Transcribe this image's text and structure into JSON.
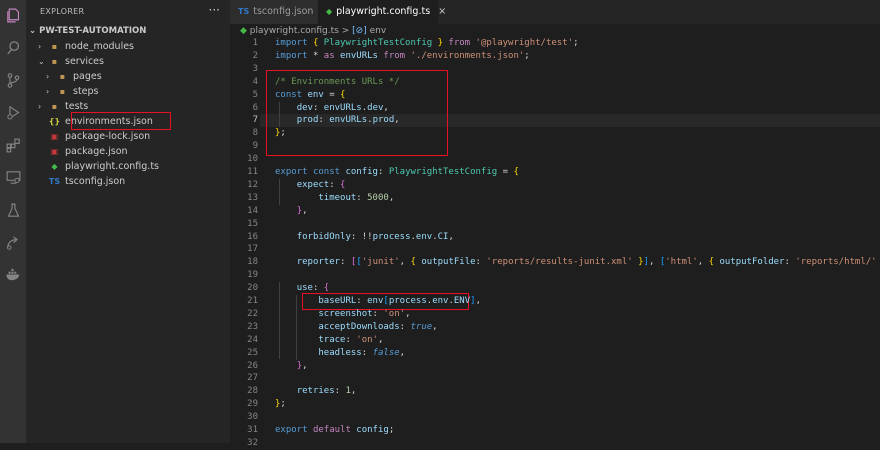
{
  "explorer": {
    "title": "EXPLORER",
    "more": "···",
    "project": "PW-TEST-AUTOMATION",
    "items": [
      {
        "label": "node_modules",
        "icon": "folder-icon",
        "depth": 0,
        "chevron": "›"
      },
      {
        "label": "services",
        "icon": "folder-icon",
        "depth": 0,
        "chevron": "⌄"
      },
      {
        "label": "pages",
        "icon": "folder-icon",
        "depth": 1,
        "chevron": "›"
      },
      {
        "label": "steps",
        "icon": "folder-icon",
        "depth": 1,
        "chevron": "›"
      },
      {
        "label": "tests",
        "icon": "folder-icon",
        "depth": 0,
        "chevron": "›"
      },
      {
        "label": "environments.json",
        "icon": "json-icon",
        "depth": 0,
        "chevron": ""
      },
      {
        "label": "package-lock.json",
        "icon": "npm-icon",
        "depth": 0,
        "chevron": ""
      },
      {
        "label": "package.json",
        "icon": "npm-icon",
        "depth": 0,
        "chevron": ""
      },
      {
        "label": "playwright.config.ts",
        "icon": "playwright-icon",
        "depth": 0,
        "chevron": ""
      },
      {
        "label": "tsconfig.json",
        "icon": "typescript-icon",
        "depth": 0,
        "chevron": ""
      }
    ]
  },
  "tabs": [
    {
      "label": "tsconfig.json",
      "icon": "TS",
      "active": false
    },
    {
      "label": "playwright.config.ts",
      "icon": "◆",
      "active": true,
      "close": "×"
    }
  ],
  "breadcrumb": {
    "file": "playwright.config.ts",
    "sep": ">",
    "symbol_icon": "[⊘]",
    "symbol": "env"
  },
  "editor": {
    "current_line": 7,
    "lines": [
      [
        [
          "k",
          "import "
        ],
        [
          "b",
          "{ "
        ],
        [
          "t",
          "PlaywrightTestConfig "
        ],
        [
          "b",
          "} "
        ],
        [
          "kc",
          "from "
        ],
        [
          "s",
          "'@playwright/test'"
        ],
        [
          "p",
          ";"
        ]
      ],
      [
        [
          "k",
          "import "
        ],
        [
          "p",
          "* "
        ],
        [
          "kc",
          "as "
        ],
        [
          "v",
          "envURLs "
        ],
        [
          "kc",
          "from "
        ],
        [
          "s",
          "'./environments.json'"
        ],
        [
          "p",
          ";"
        ]
      ],
      [],
      [
        [
          "c",
          "/* Environments URLs */"
        ]
      ],
      [
        [
          "k",
          "const "
        ],
        [
          "v",
          "env "
        ],
        [
          "p",
          "= "
        ],
        [
          "b",
          "{"
        ]
      ],
      [
        [
          "p",
          "    "
        ],
        [
          "v",
          "dev"
        ],
        [
          "p",
          ": "
        ],
        [
          "v",
          "envURLs"
        ],
        [
          "p",
          "."
        ],
        [
          "v",
          "dev"
        ],
        [
          "p",
          ","
        ]
      ],
      [
        [
          "p",
          "    "
        ],
        [
          "v",
          "prod"
        ],
        [
          "p",
          ": "
        ],
        [
          "v",
          "envURLs"
        ],
        [
          "p",
          "."
        ],
        [
          "v",
          "prod"
        ],
        [
          "p",
          ","
        ]
      ],
      [
        [
          "b",
          "}"
        ],
        [
          "p",
          ";"
        ]
      ],
      [],
      [],
      [
        [
          "k",
          "export "
        ],
        [
          "k",
          "const "
        ],
        [
          "v",
          "config"
        ],
        [
          "p",
          ": "
        ],
        [
          "t",
          "PlaywrightTestConfig "
        ],
        [
          "p",
          "= "
        ],
        [
          "b",
          "{"
        ]
      ],
      [
        [
          "p",
          "    "
        ],
        [
          "v",
          "expect"
        ],
        [
          "p",
          ": "
        ],
        [
          "b2",
          "{"
        ]
      ],
      [
        [
          "p",
          "        "
        ],
        [
          "v",
          "timeout"
        ],
        [
          "p",
          ": "
        ],
        [
          "n",
          "5000"
        ],
        [
          "p",
          ","
        ]
      ],
      [
        [
          "p",
          "    "
        ],
        [
          "b2",
          "}"
        ],
        [
          "p",
          ","
        ]
      ],
      [],
      [
        [
          "p",
          "    "
        ],
        [
          "v",
          "forbidOnly"
        ],
        [
          "p",
          ": !!"
        ],
        [
          "v",
          "process"
        ],
        [
          "p",
          "."
        ],
        [
          "v",
          "env"
        ],
        [
          "p",
          "."
        ],
        [
          "v",
          "CI"
        ],
        [
          "p",
          ","
        ]
      ],
      [],
      [
        [
          "p",
          "    "
        ],
        [
          "v",
          "reporter"
        ],
        [
          "p",
          ": "
        ],
        [
          "b2",
          "["
        ],
        [
          "b3",
          "["
        ],
        [
          "s",
          "'junit'"
        ],
        [
          "p",
          ", "
        ],
        [
          "b",
          "{ "
        ],
        [
          "v",
          "outputFile"
        ],
        [
          "p",
          ": "
        ],
        [
          "s",
          "'reports/results-junit.xml'"
        ],
        [
          "b",
          " }"
        ],
        [
          "b3",
          "]"
        ],
        [
          "p",
          ", "
        ],
        [
          "b3",
          "["
        ],
        [
          "s",
          "'html'"
        ],
        [
          "p",
          ", "
        ],
        [
          "b",
          "{ "
        ],
        [
          "v",
          "outputFolder"
        ],
        [
          "p",
          ": "
        ],
        [
          "s",
          "'reports/html/'"
        ],
        [
          "b",
          " }"
        ],
        [
          "b3",
          "]"
        ],
        [
          "b2",
          "]"
        ],
        [
          "p",
          ","
        ]
      ],
      [],
      [
        [
          "p",
          "    "
        ],
        [
          "v",
          "use"
        ],
        [
          "p",
          ": "
        ],
        [
          "b2",
          "{"
        ]
      ],
      [
        [
          "p",
          "        "
        ],
        [
          "v",
          "baseURL"
        ],
        [
          "p",
          ": "
        ],
        [
          "v",
          "env"
        ],
        [
          "b3",
          "["
        ],
        [
          "v",
          "process"
        ],
        [
          "p",
          "."
        ],
        [
          "v",
          "env"
        ],
        [
          "p",
          "."
        ],
        [
          "v",
          "ENV"
        ],
        [
          "b3",
          "]"
        ],
        [
          "p",
          ","
        ]
      ],
      [
        [
          "p",
          "        "
        ],
        [
          "v",
          "screenshot"
        ],
        [
          "p",
          ": "
        ],
        [
          "s",
          "'on'"
        ],
        [
          "p",
          ","
        ]
      ],
      [
        [
          "p",
          "        "
        ],
        [
          "v",
          "acceptDownloads"
        ],
        [
          "p",
          ": "
        ],
        [
          "k i",
          "true"
        ],
        [
          "p",
          ","
        ]
      ],
      [
        [
          "p",
          "        "
        ],
        [
          "v",
          "trace"
        ],
        [
          "p",
          ": "
        ],
        [
          "s",
          "'on'"
        ],
        [
          "p",
          ","
        ]
      ],
      [
        [
          "p",
          "        "
        ],
        [
          "v",
          "headless"
        ],
        [
          "p",
          ": "
        ],
        [
          "k i",
          "false"
        ],
        [
          "p",
          ","
        ]
      ],
      [
        [
          "p",
          "    "
        ],
        [
          "b2",
          "}"
        ],
        [
          "p",
          ","
        ]
      ],
      [],
      [
        [
          "p",
          "    "
        ],
        [
          "v",
          "retries"
        ],
        [
          "p",
          ": "
        ],
        [
          "n",
          "1"
        ],
        [
          "p",
          ","
        ]
      ],
      [
        [
          "b",
          "}"
        ],
        [
          "p",
          ";"
        ]
      ],
      [],
      [
        [
          "k",
          "export "
        ],
        [
          "kc",
          "default "
        ],
        [
          "v",
          "config"
        ],
        [
          "p",
          ";"
        ]
      ],
      []
    ]
  },
  "colors": {
    "accent": "#e81123",
    "activity_bar": "#333333",
    "sidebar": "#252526",
    "editor_bg": "#1e1e1e"
  },
  "activity_icons": [
    "explorer-icon",
    "search-icon",
    "source-control-icon",
    "run-debug-icon",
    "extensions-icon",
    "remote-explorer-icon",
    "testing-icon",
    "live-share-icon",
    "docker-icon"
  ]
}
